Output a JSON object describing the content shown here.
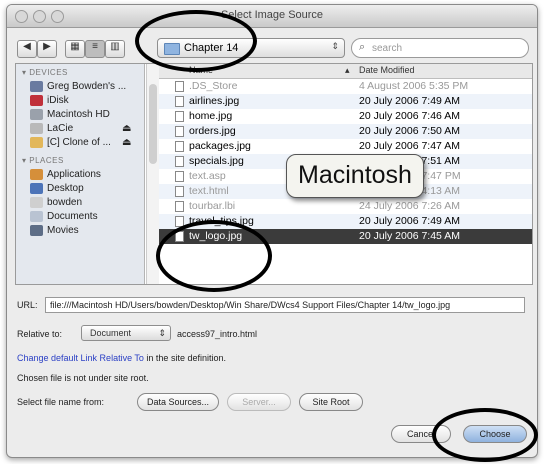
{
  "window": {
    "title": "Select Image Source"
  },
  "toolbar": {
    "back": "◀",
    "forward": "▶",
    "view_icon": "▦",
    "view_list": "≡",
    "view_column": "▥",
    "location": "Chapter 14",
    "search_placeholder": "search"
  },
  "sidebar": {
    "devices_header": "DEVICES",
    "devices": [
      {
        "label": "Greg Bowden's ...",
        "icon": "computer-icon"
      },
      {
        "label": "iDisk",
        "icon": "idisk-icon"
      },
      {
        "label": "Macintosh HD",
        "icon": "harddisk-icon"
      },
      {
        "label": "LaCie",
        "icon": "external-disk-icon",
        "eject": "⏏"
      },
      {
        "label": "[C] Clone of ...",
        "icon": "disk-image-icon",
        "eject": "⏏"
      }
    ],
    "places_header": "PLACES",
    "places": [
      {
        "label": "Applications",
        "icon": "applications-icon"
      },
      {
        "label": "Desktop",
        "icon": "desktop-icon"
      },
      {
        "label": "bowden",
        "icon": "home-icon"
      },
      {
        "label": "Documents",
        "icon": "documents-icon"
      },
      {
        "label": "Movies",
        "icon": "movies-icon"
      }
    ]
  },
  "file_list": {
    "col_name": "Name",
    "col_date": "Date Modified",
    "rows": [
      {
        "name": ".DS_Store",
        "date": "4 August 2006 5:35 PM",
        "dim": true
      },
      {
        "name": "airlines.jpg",
        "date": "20 July 2006 7:49 AM",
        "dim": false
      },
      {
        "name": "home.jpg",
        "date": "20 July 2006 7:46 AM",
        "dim": false
      },
      {
        "name": "orders.jpg",
        "date": "20 July 2006 7:50 AM",
        "dim": false
      },
      {
        "name": "packages.jpg",
        "date": "20 July 2006 7:47 AM",
        "dim": false
      },
      {
        "name": "specials.jpg",
        "date": "20 July 2006 7:51 AM",
        "dim": false
      },
      {
        "name": "text.asp",
        "date": "20 July 2006 7:47 PM",
        "dim": true
      },
      {
        "name": "text.html",
        "date": "21 July 2006 4:13 AM",
        "dim": true
      },
      {
        "name": "tourbar.lbi",
        "date": "24 July 2006 7:26 AM",
        "dim": true
      },
      {
        "name": "travel_tips.jpg",
        "date": "20 July 2006 7:49 AM",
        "dim": false
      },
      {
        "name": "tw_logo.jpg",
        "date": "20 July 2006 7:45 AM",
        "dim": false,
        "selected": true
      }
    ]
  },
  "options": {
    "url_label": "URL:",
    "url_value": "file:///Macintosh HD/Users/bowden/Desktop/Win Share/DWcs4 Support Files/Chapter 14/tw_logo.jpg",
    "relative_label": "Relative to:",
    "relative_value": "Document",
    "relative_file": "access97_intro.html",
    "change_link": "Change default Link Relative To",
    "change_rest": " in the site definition.",
    "not_under_root": "Chosen file is not under site root.",
    "select_from_label": "Select file name from:",
    "data_sources": "Data Sources...",
    "server": "Server...",
    "site_root": "Site Root",
    "cancel": "Cancel",
    "choose": "Choose"
  },
  "annotation": {
    "callout": "Macintosh"
  }
}
